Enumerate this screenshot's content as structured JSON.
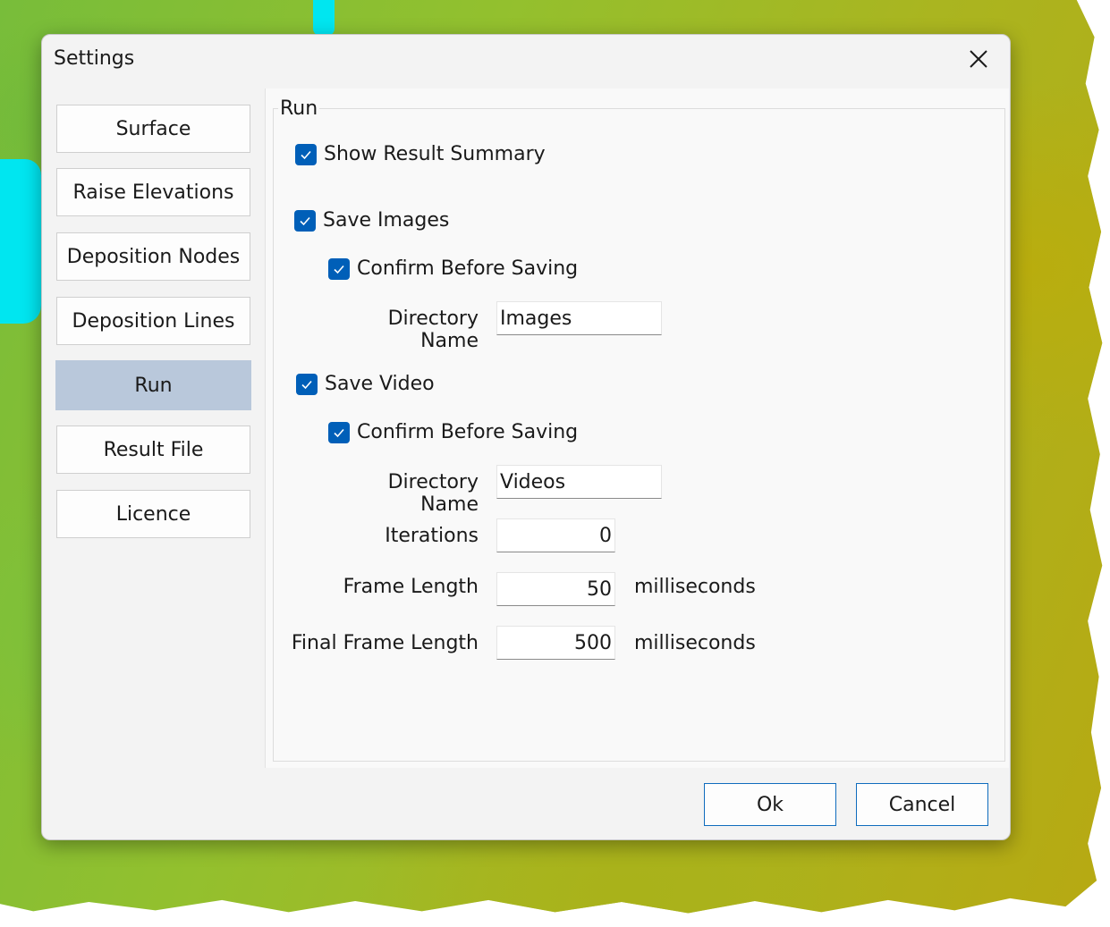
{
  "dialog": {
    "title": "Settings",
    "close_icon": "close-icon"
  },
  "sidebar": {
    "items": [
      {
        "label": "Surface",
        "active": false
      },
      {
        "label": "Raise Elevations",
        "active": false
      },
      {
        "label": "Deposition Nodes",
        "active": false
      },
      {
        "label": "Deposition Lines",
        "active": false
      },
      {
        "label": "Run",
        "active": true
      },
      {
        "label": "Result File",
        "active": false
      },
      {
        "label": "Licence",
        "active": false
      }
    ]
  },
  "run": {
    "group_title": "Run",
    "show_result_summary": {
      "label": "Show Result Summary",
      "checked": true
    },
    "save_images": {
      "label": "Save Images",
      "checked": true
    },
    "images_confirm": {
      "label": "Confirm Before Saving",
      "checked": true
    },
    "images_directory": {
      "label": "Directory Name",
      "value": "Images"
    },
    "save_video": {
      "label": "Save Video",
      "checked": true
    },
    "video_confirm": {
      "label": "Confirm Before Saving",
      "checked": true
    },
    "video_directory": {
      "label": "Directory Name",
      "value": "Videos"
    },
    "iterations": {
      "label": "Iterations",
      "value": "0"
    },
    "frame_length": {
      "label": "Frame Length",
      "value": "50",
      "unit": "milliseconds"
    },
    "final_frame_length": {
      "label": "Final Frame Length",
      "value": "500",
      "unit": "milliseconds"
    }
  },
  "footer": {
    "ok_label": "Ok",
    "cancel_label": "Cancel"
  },
  "colors": {
    "accent": "#005fb8",
    "active_nav": "#b9c8db",
    "button_border": "#0f6cbd"
  }
}
